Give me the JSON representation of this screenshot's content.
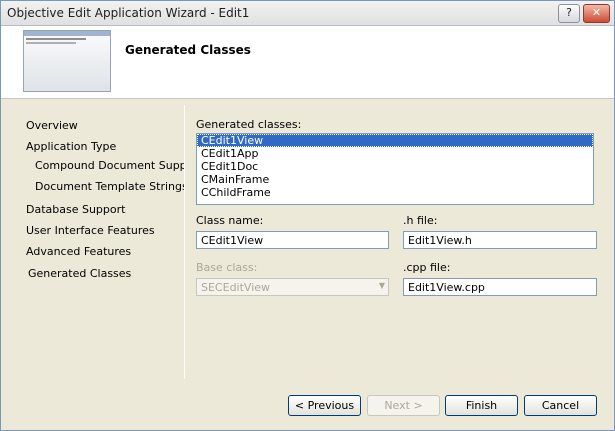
{
  "window": {
    "title": "Objective Edit Application Wizard - Edit1",
    "help_label": "?",
    "close_label": "✕"
  },
  "header": {
    "title": "Generated Classes"
  },
  "nav": {
    "items": [
      {
        "label": "Overview",
        "indent": 0
      },
      {
        "label": "Application Type",
        "indent": 0
      },
      {
        "label": "Compound Document Support",
        "indent": 1
      },
      {
        "label": "Document Template Strings",
        "indent": 1
      },
      {
        "label": "Database Support",
        "indent": 0
      },
      {
        "label": "User Interface Features",
        "indent": 0
      },
      {
        "label": "Advanced Features",
        "indent": 0
      },
      {
        "label": "Generated Classes",
        "indent": 0,
        "selected": true
      }
    ]
  },
  "classes": {
    "label": "Generated classes:",
    "items": [
      "CEdit1View",
      "CEdit1App",
      "CEdit1Doc",
      "CMainFrame",
      "CChildFrame"
    ],
    "selected": "CEdit1View"
  },
  "fields": {
    "class_name_label": "Class name:",
    "class_name_value": "CEdit1View",
    "h_file_label": ".h file:",
    "h_file_value": "Edit1View.h",
    "base_class_label": "Base class:",
    "base_class_value": "SECEditView",
    "cpp_file_label": ".cpp file:",
    "cpp_file_value": "Edit1View.cpp"
  },
  "buttons": {
    "previous": "< Previous",
    "next": "Next >",
    "finish": "Finish",
    "cancel": "Cancel"
  },
  "colors": {
    "selection": "#316ac5",
    "panel": "#ece9d8",
    "header": "#ffffff"
  }
}
